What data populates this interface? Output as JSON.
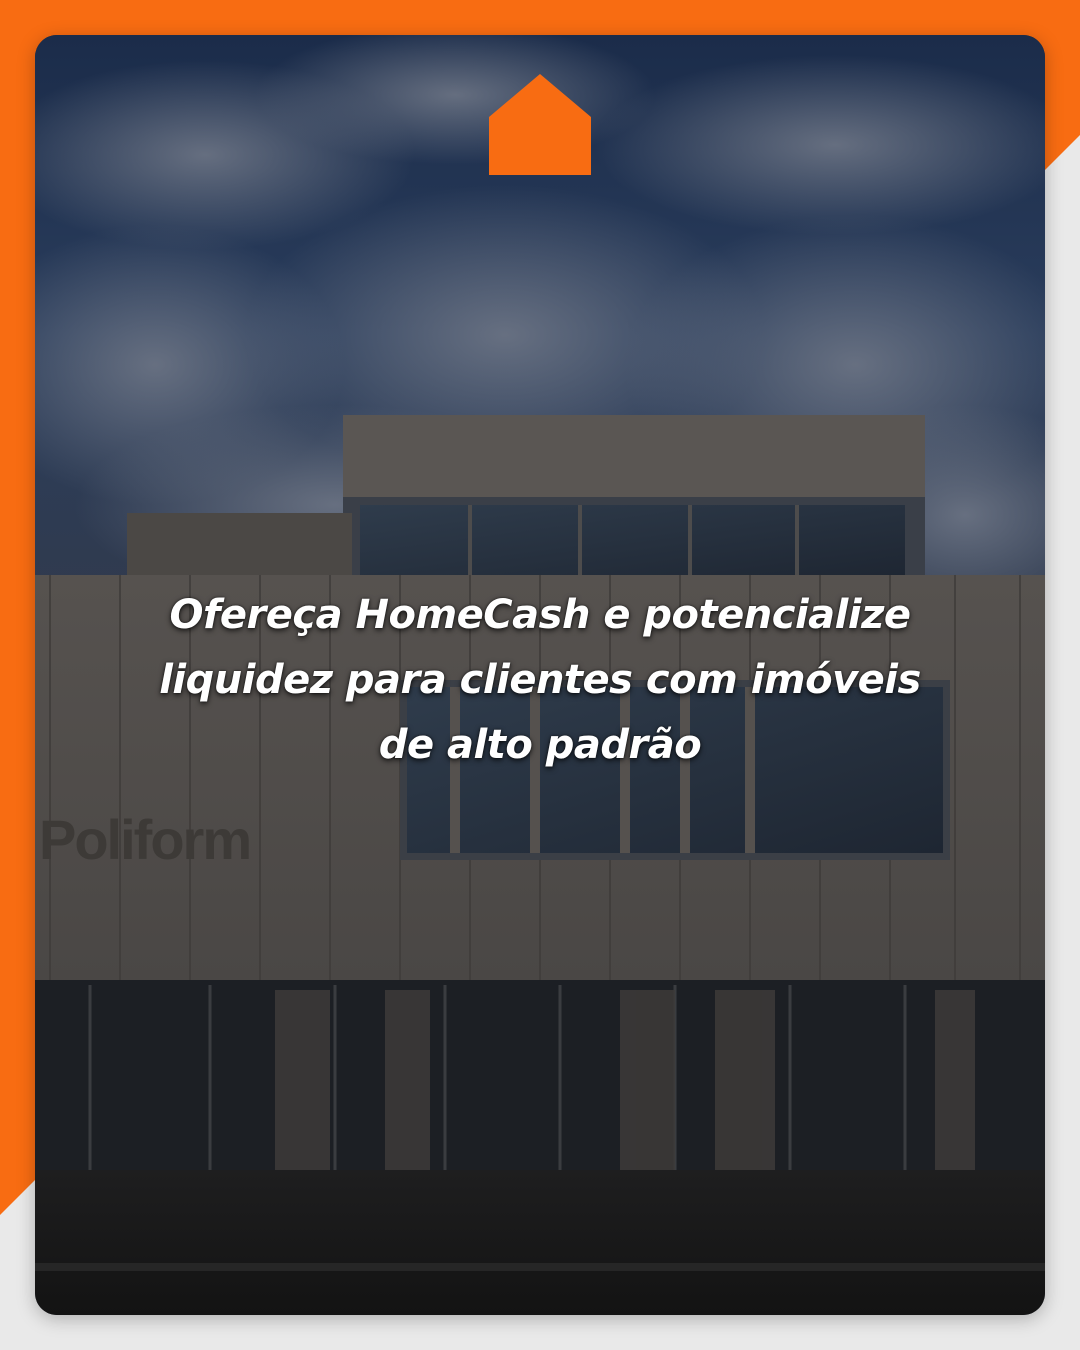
{
  "headline": {
    "line1": "Ofereça HomeCash e potencialize",
    "line2": "liquidez para clientes com imóveis",
    "line3": "de alto padrão"
  },
  "photo": {
    "sign_text": "Poliform"
  },
  "logo": {
    "icon": "house-icon"
  },
  "colors": {
    "brand_orange": "#f86c12",
    "background": "#e9e9e9",
    "headline_text": "#ffffff"
  }
}
